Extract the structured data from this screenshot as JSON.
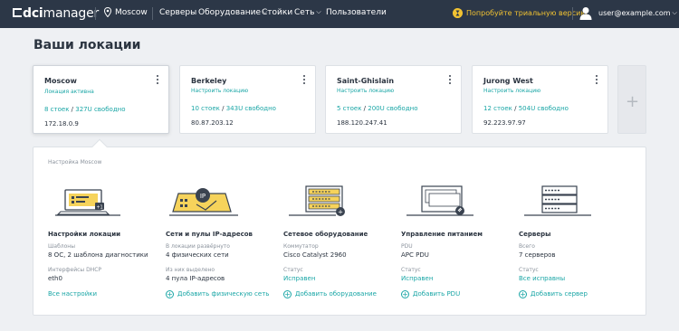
{
  "topbar": {
    "logo_bold": "dci",
    "logo_light": "manager",
    "location": "Moscow",
    "nav": [
      {
        "label": "Серверы",
        "dropdown": false
      },
      {
        "label": "Оборудование",
        "dropdown": true
      },
      {
        "label": "Стойки",
        "dropdown": false
      },
      {
        "label": "Сеть",
        "dropdown": true
      },
      {
        "label": "Пользователи",
        "dropdown": false
      }
    ],
    "trial": "Попробуйте триальную версию",
    "user": "user@example.com"
  },
  "page_title": "Ваши локации",
  "locations": [
    {
      "name": "Moscow",
      "link": "Локация активна",
      "racks": "8 стоек",
      "free": "327U свободно",
      "ip": "172.18.0.9",
      "active": true
    },
    {
      "name": "Berkeley",
      "link": "Настроить локацию",
      "racks": "10 стоек",
      "free": "343U свободно",
      "ip": "80.87.203.12",
      "active": false
    },
    {
      "name": "Saint-Ghislain",
      "link": "Настроить локацию",
      "racks": "5 стоек",
      "free": "200U свободно",
      "ip": "188.120.247.41",
      "active": false
    },
    {
      "name": "Jurong West",
      "link": "Настроить локацию",
      "racks": "12 стоек",
      "free": "504U свободно",
      "ip": "92.223.97.97",
      "active": false
    }
  ],
  "add_location_symbol": "+",
  "panel": {
    "label": "Настройка Moscow",
    "columns": [
      {
        "title": "Настройки локации",
        "l1": "Шаблоны",
        "v1": "8 ОС, 2 шаблона диагностики",
        "l2": "Интерфейсы DHCP",
        "v2": "eth0",
        "action": "Все настройки",
        "action_plus": false
      },
      {
        "title": "Сети и пулы IP-адресов",
        "l1": "В локации развёрнуто",
        "v1": "4 физических сети",
        "l2": "Из них выделено",
        "v2": "4 пула IP-адресов",
        "action": "Добавить физическую сеть",
        "action_plus": true
      },
      {
        "title": "Сетевое оборудование",
        "l1": "Коммутатор",
        "v1": "Cisco Catalyst 2960",
        "l2": "Статус",
        "v2": "Исправен",
        "action": "Добавить оборудование",
        "action_plus": true
      },
      {
        "title": "Управление питанием",
        "l1": "PDU",
        "v1": "APC PDU",
        "l2": "Статус",
        "v2": "Исправен",
        "action": "Добавить PDU",
        "action_plus": true
      },
      {
        "title": "Серверы",
        "l1": "Всего",
        "v1": "7 серверов",
        "l2": "Статус",
        "v2": "Все исправны",
        "action": "Добавить сервер",
        "action_plus": true
      }
    ]
  },
  "colors": {
    "topbar": "#2c3747",
    "accent": "#1aa6a6",
    "trial": "#f1c232"
  },
  "icons": [
    "map-pin-icon",
    "trial-badge-icon",
    "user-icon",
    "kebab-menu-icon",
    "plus-icon"
  ]
}
